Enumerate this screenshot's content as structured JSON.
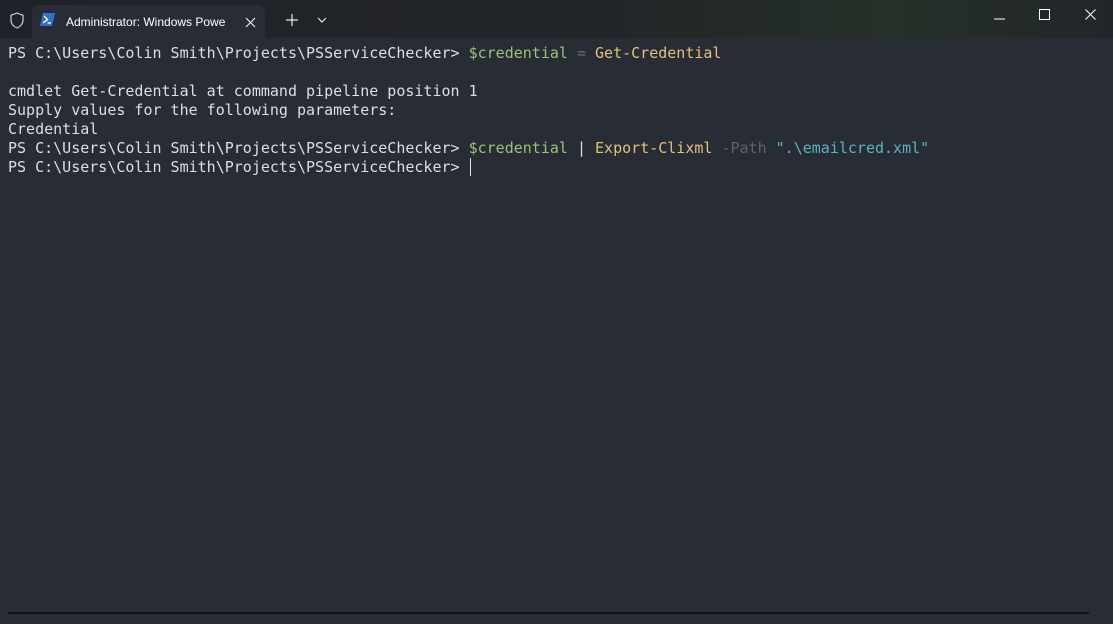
{
  "tab": {
    "title": "Administrator: Windows Powe",
    "icon": "powershell-icon"
  },
  "titlebar": {
    "shield_icon": "shield-icon",
    "new_tab_icon": "plus-icon",
    "dropdown_icon": "chevron-down-icon",
    "minimize_icon": "minimize-icon",
    "maximize_icon": "maximize-icon",
    "close_icon": "close-icon"
  },
  "colors": {
    "background": "#282c34",
    "text": "#dcdfe4",
    "variable": "#98c379",
    "command": "#e5c07b",
    "string": "#56b6c2",
    "parameter": "#5c6370"
  },
  "terminal": {
    "line1": {
      "prompt": "PS C:\\Users\\Colin Smith\\Projects\\PSServiceChecker> ",
      "variable": "$credential",
      "operator": " = ",
      "command": "Get-Credential"
    },
    "line2": "cmdlet Get-Credential at command pipeline position 1",
    "line3": "Supply values for the following parameters:",
    "line4": "Credential",
    "line5": {
      "prompt": "PS C:\\Users\\Colin Smith\\Projects\\PSServiceChecker> ",
      "variable": "$credential",
      "pipe": " | ",
      "command": "Export-Clixml",
      "parameter": " -Path ",
      "string": "\".\\emailcred.xml\""
    },
    "line6": {
      "prompt": "PS C:\\Users\\Colin Smith\\Projects\\PSServiceChecker> "
    }
  }
}
